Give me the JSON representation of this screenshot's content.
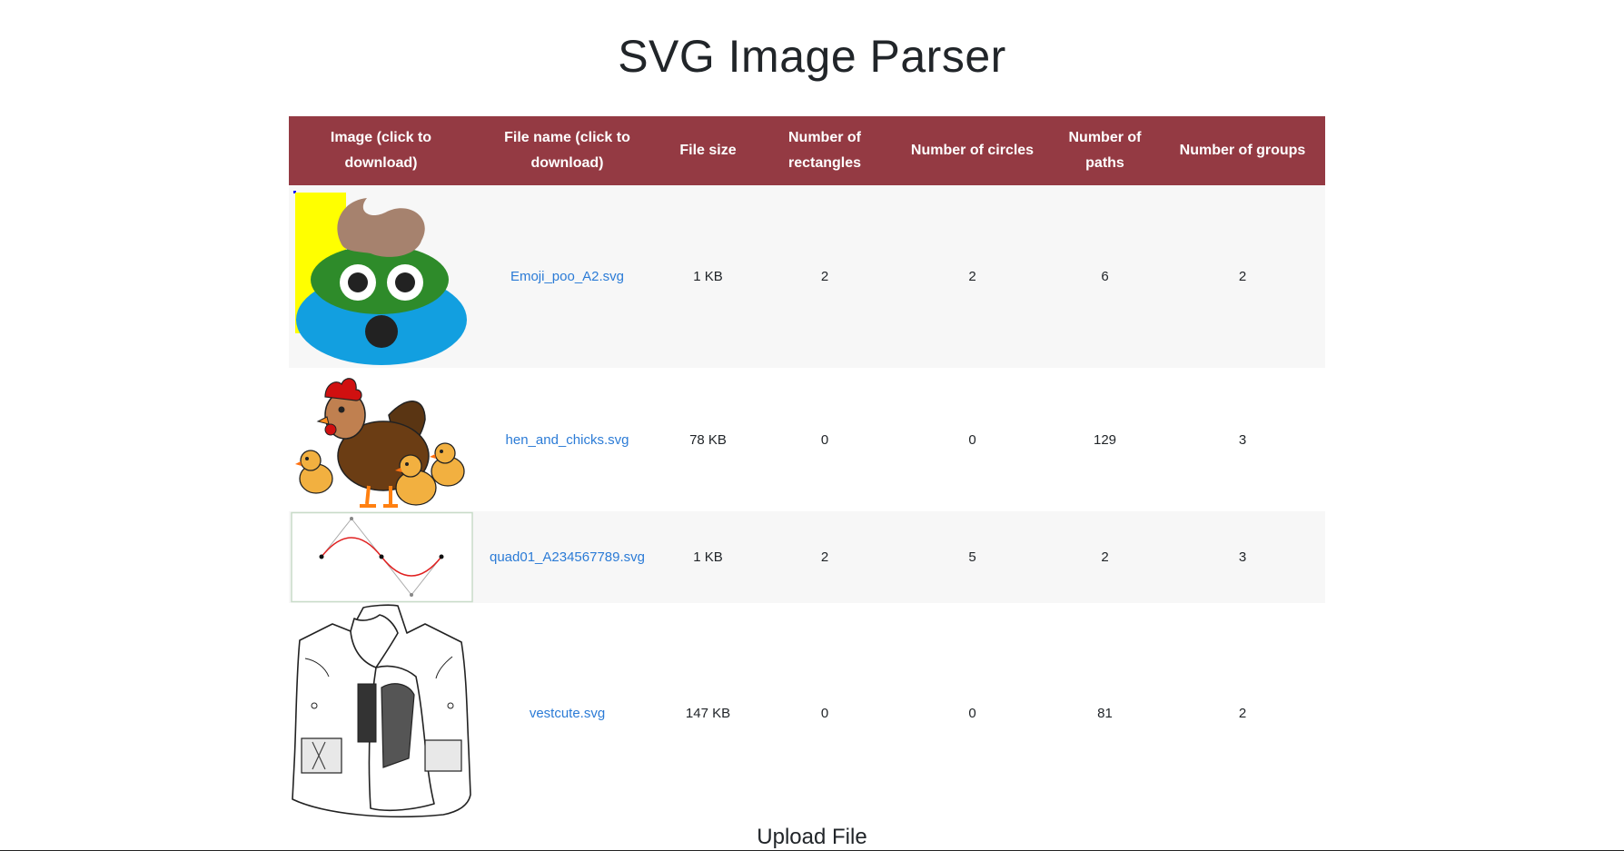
{
  "page": {
    "title": "SVG Image Parser",
    "upload_heading": "Upload File"
  },
  "table": {
    "header_color": "#943a43",
    "columns": [
      "Image (click to download)",
      "File name (click to download)",
      "File size",
      "Number of rectangles",
      "Number of circles",
      "Number of paths",
      "Number of groups"
    ],
    "rows": [
      {
        "file": "Emoji_poo_A2.svg",
        "size": "1 KB",
        "rects": "2",
        "circles": "2",
        "paths": "6",
        "groups": "2",
        "image": "emoji-poo-thumbnail"
      },
      {
        "file": "hen_and_chicks.svg",
        "size": "78 KB",
        "rects": "0",
        "circles": "0",
        "paths": "129",
        "groups": "3",
        "image": "hen-and-chicks-thumbnail"
      },
      {
        "file": "quad01_A234567789.svg",
        "size": "1 KB",
        "rects": "2",
        "circles": "5",
        "paths": "2",
        "groups": "3",
        "image": "quadratic-curve-thumbnail"
      },
      {
        "file": "vestcute.svg",
        "size": "147 KB",
        "rects": "0",
        "circles": "0",
        "paths": "81",
        "groups": "2",
        "image": "vest-thumbnail"
      }
    ]
  }
}
